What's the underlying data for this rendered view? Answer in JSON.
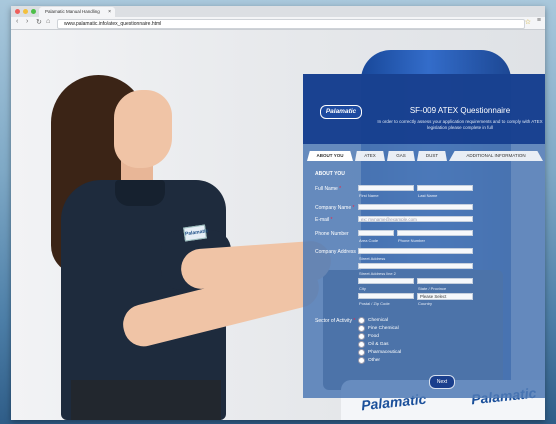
{
  "browser": {
    "tab_title": "Palamatic Manual Handling",
    "tab_close": "×",
    "url": "www.palamatic.info/atex_questionnaire.html",
    "nav_back": "‹",
    "nav_forward": "›",
    "nav_reload": "↻",
    "nav_home": "⌂",
    "star": "☆",
    "menu": "≡",
    "traffic_colors": [
      "#ee5f5b",
      "#f3c03d",
      "#4dbf49"
    ]
  },
  "form": {
    "logo": "Palamatic",
    "title": "SF-009 ATEX Questionnaire",
    "subtitle": "In order to correctly assess your application requirements and to comply with ATEX legislation please complete in full",
    "tabs": [
      "ABOUT YOU",
      "ATEX",
      "GAS",
      "DUST",
      "ADDITIONAL INFORMATION"
    ],
    "section": "ABOUT YOU",
    "labels": {
      "full_name": "Full Name",
      "company_name": "Company Name",
      "email": "E-mail",
      "phone": "Phone Number",
      "address": "Company Address",
      "sector": "Sector of Activity"
    },
    "hints": {
      "first_name": "First Name",
      "last_name": "Last Name",
      "area_code": "Area Code",
      "phone_number": "Phone Number",
      "street_address": "Street Address",
      "street_address_2": "Street Address line 2",
      "city": "City",
      "state": "State / Province",
      "postal": "Postal / Zip Code",
      "country": "Country"
    },
    "email_placeholder": "ex: myname@example.com",
    "country_select": "Please Select",
    "sectors": [
      "Chemical",
      "Fine Chemical",
      "Food",
      "Oil & Gas",
      "Pharmaceutical",
      "Other"
    ],
    "next_button": "Next"
  },
  "scene": {
    "badge_text": "Palamatic",
    "bag_logo": "Palamatic"
  }
}
